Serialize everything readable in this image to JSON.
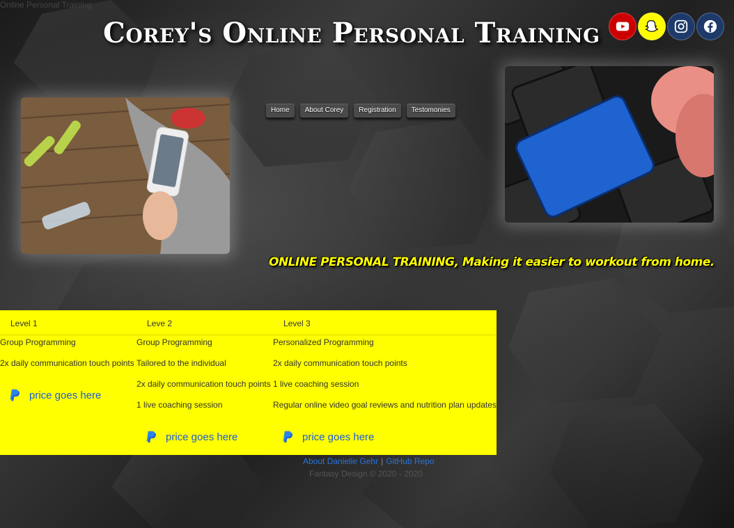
{
  "page": {
    "doc_title": "Online Personal Training"
  },
  "header": {
    "brand": "Corey's Online Personal Training"
  },
  "social": [
    {
      "icon": "youtube-icon",
      "color": "#cc0000"
    },
    {
      "icon": "snapchat-icon",
      "color": "#fffc00"
    },
    {
      "icon": "instagram-icon",
      "color": "#1e3a6a"
    },
    {
      "icon": "facebook-icon",
      "color": "#1e3a6a"
    }
  ],
  "nav": {
    "items": [
      "Home",
      "About Corey",
      "Registration",
      "Testomonies"
    ]
  },
  "tagline": "ONLINE PERSONAL TRAINING, Making it easier to workout from home.",
  "pricing": {
    "background": "#ffff00",
    "headers": [
      "Level 1",
      "Leve 2",
      "Level 3"
    ],
    "col1": [
      "Group Programming",
      "2x daily communication touch points"
    ],
    "col2": [
      "Group Programming",
      "Tailored to the individual",
      "2x daily communication touch points",
      "1 live coaching session"
    ],
    "col3": [
      "Personalized Programming",
      "2x daily communication touch points",
      "1 live coaching session",
      "Regular online video goal reviews and nutrition plan updates"
    ],
    "paypal_label": "price goes here"
  },
  "footer": {
    "link_about": "About Danielle Gehr",
    "separator": "|",
    "link_repo": "GitHub Repo",
    "copyright": "Fantasy Design © 2020 - 2020"
  }
}
